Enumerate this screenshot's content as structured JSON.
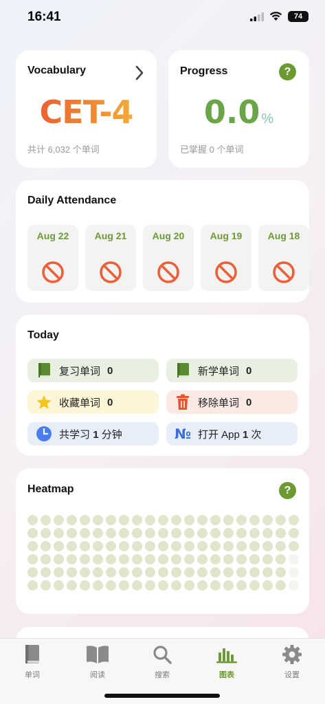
{
  "status_bar": {
    "time": "16:41",
    "battery": "74"
  },
  "vocabulary": {
    "title": "Vocabulary",
    "level": "CET-4",
    "total_text": "共计 6,032 个单词"
  },
  "progress": {
    "title": "Progress",
    "value": "0.0",
    "unit": "%",
    "mastered_text": "已掌握 0 个单词",
    "help": "?"
  },
  "attendance": {
    "title": "Daily Attendance",
    "days": [
      {
        "label": "Aug 22",
        "status_icon": "prohibited-icon"
      },
      {
        "label": "Aug 21",
        "status_icon": "prohibited-icon"
      },
      {
        "label": "Aug 20",
        "status_icon": "prohibited-icon"
      },
      {
        "label": "Aug 19",
        "status_icon": "prohibited-icon"
      },
      {
        "label": "Aug 18",
        "status_icon": "prohibited-icon"
      }
    ]
  },
  "today": {
    "title": "Today",
    "review": {
      "label": "复习单词",
      "count": "0"
    },
    "new": {
      "label": "新学单词",
      "count": "0"
    },
    "favorite": {
      "label": "收藏单词",
      "count": "0"
    },
    "removed": {
      "label": "移除单词",
      "count": "0"
    },
    "study": {
      "prefix": "共学习",
      "value": "1",
      "suffix": "分钟"
    },
    "opens": {
      "prefix": "打开 App",
      "value": "1",
      "suffix": "次"
    }
  },
  "heatmap": {
    "title": "Heatmap",
    "help": "?"
  },
  "tabs": [
    {
      "label": "单词",
      "icon": "book-icon"
    },
    {
      "label": "阅读",
      "icon": "open-book-icon"
    },
    {
      "label": "搜索",
      "icon": "search-icon"
    },
    {
      "label": "图表",
      "icon": "chart-icon"
    },
    {
      "label": "设置",
      "icon": "gear-icon"
    }
  ],
  "colors": {
    "accent_green": "#6d9a36",
    "attendance_red": "#e9603a",
    "star": "#f5c51e",
    "trash": "#e8522e",
    "clock": "#4a7ef0"
  }
}
